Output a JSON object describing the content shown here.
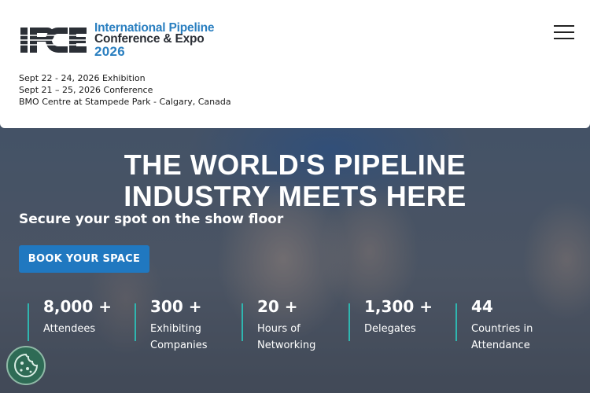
{
  "header": {
    "logo": {
      "mark": "IPCE",
      "line1": "International Pipeline",
      "line2": "Conference & Expo",
      "year": "2026"
    },
    "event_info": [
      "Sept 22 - 24, 2026 Exhibition",
      "Sept 21 – 25, 2026 Conference",
      "BMO Centre at Stampede Park - Calgary, Canada"
    ],
    "menu_icon": "hamburger-menu-icon"
  },
  "hero": {
    "headline_line1": "THE WORLD'S PIPELINE",
    "headline_line2": "INDUSTRY MEETS HERE",
    "subhead": "Secure your spot on the show floor",
    "cta_label": "BOOK YOUR SPACE",
    "stats": [
      {
        "value": "8,000 +",
        "label": "Attendees"
      },
      {
        "value": "300 +",
        "label": "Exhibiting Companies"
      },
      {
        "value": "20 +",
        "label": "Hours of Networking"
      },
      {
        "value": "1,300 +",
        "label": "Delegates"
      },
      {
        "value": "44",
        "label": "Countries in Attendance"
      }
    ]
  },
  "cookie": {
    "icon": "cookie-icon"
  },
  "colors": {
    "brand_blue": "#2a7fc0",
    "cta_blue": "#2078c0",
    "stat_accent": "#2fb6b0",
    "cookie_green": "#2e6b55"
  }
}
